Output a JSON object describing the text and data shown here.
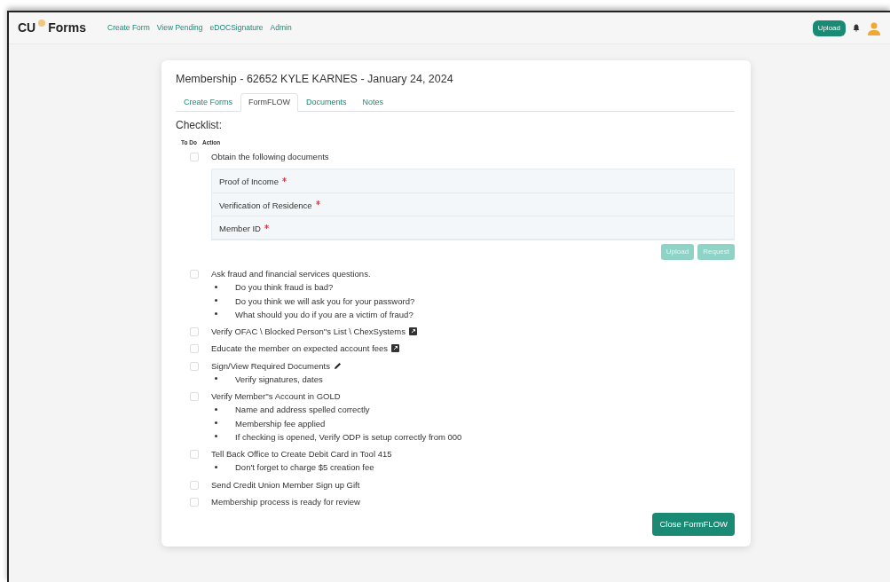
{
  "navbar": {
    "brand": "CU",
    "brand_suffix": "Forms",
    "links": [
      "Create Form",
      "View Pending",
      "eDOCSignature",
      "Admin"
    ],
    "upload_button": "Upload"
  },
  "card": {
    "title": "Membership - 62652 KYLE KARNES - January 24, 2024",
    "tabs": [
      {
        "label": "Create Forms",
        "selected": false
      },
      {
        "label": "FormFLOW",
        "selected": true
      },
      {
        "label": "Documents",
        "selected": false
      },
      {
        "label": "Notes",
        "selected": false
      }
    ],
    "checklist_title": "Checklist:",
    "columns": [
      "To Do",
      "Action"
    ],
    "items": [
      {
        "kind": "documents",
        "text": "Obtain the following documents",
        "checked": false,
        "documents": [
          {
            "name": "Proof of Income",
            "required": true
          },
          {
            "name": "Verification of Residence",
            "required": true
          },
          {
            "name": "Member ID",
            "required": true
          }
        ],
        "buttons": [
          {
            "label": "Upload",
            "disabled": true
          },
          {
            "label": "Request",
            "disabled": true
          }
        ]
      },
      {
        "kind": "task",
        "text": "Ask fraud and financial services questions.",
        "checked": false,
        "bullets": [
          "Do you think fraud is bad?",
          "Do you think we will ask you for your password?",
          "What should you do if you are a victim of fraud?"
        ]
      },
      {
        "kind": "link",
        "text": "Verify OFAC \\ Blocked Person''s List \\ ChexSystems",
        "checked": false
      },
      {
        "kind": "link",
        "text": "Educate the member on expected account fees",
        "checked": false
      },
      {
        "kind": "edit",
        "text": "Sign/View Required Documents",
        "checked": false,
        "bullets": [
          "Verify signatures, dates"
        ]
      },
      {
        "kind": "task",
        "text": "Verify Member''s Account in GOLD",
        "checked": false,
        "bullets": [
          "Name and address spelled correctly",
          "Membership fee applied",
          "If checking is opened, Verify ODP is setup correctly from 000"
        ]
      },
      {
        "kind": "task",
        "text": "Tell Back Office to Create Debit Card in Tool 415",
        "checked": false,
        "bullets": [
          "Don't forget to charge $5 creation fee"
        ]
      },
      {
        "kind": "task",
        "text": "Send Credit Union Member Sign up Gift",
        "checked": false
      },
      {
        "kind": "task",
        "text": "Membership process is ready for review",
        "checked": false
      }
    ],
    "close_button": "Close FormFLOW"
  }
}
